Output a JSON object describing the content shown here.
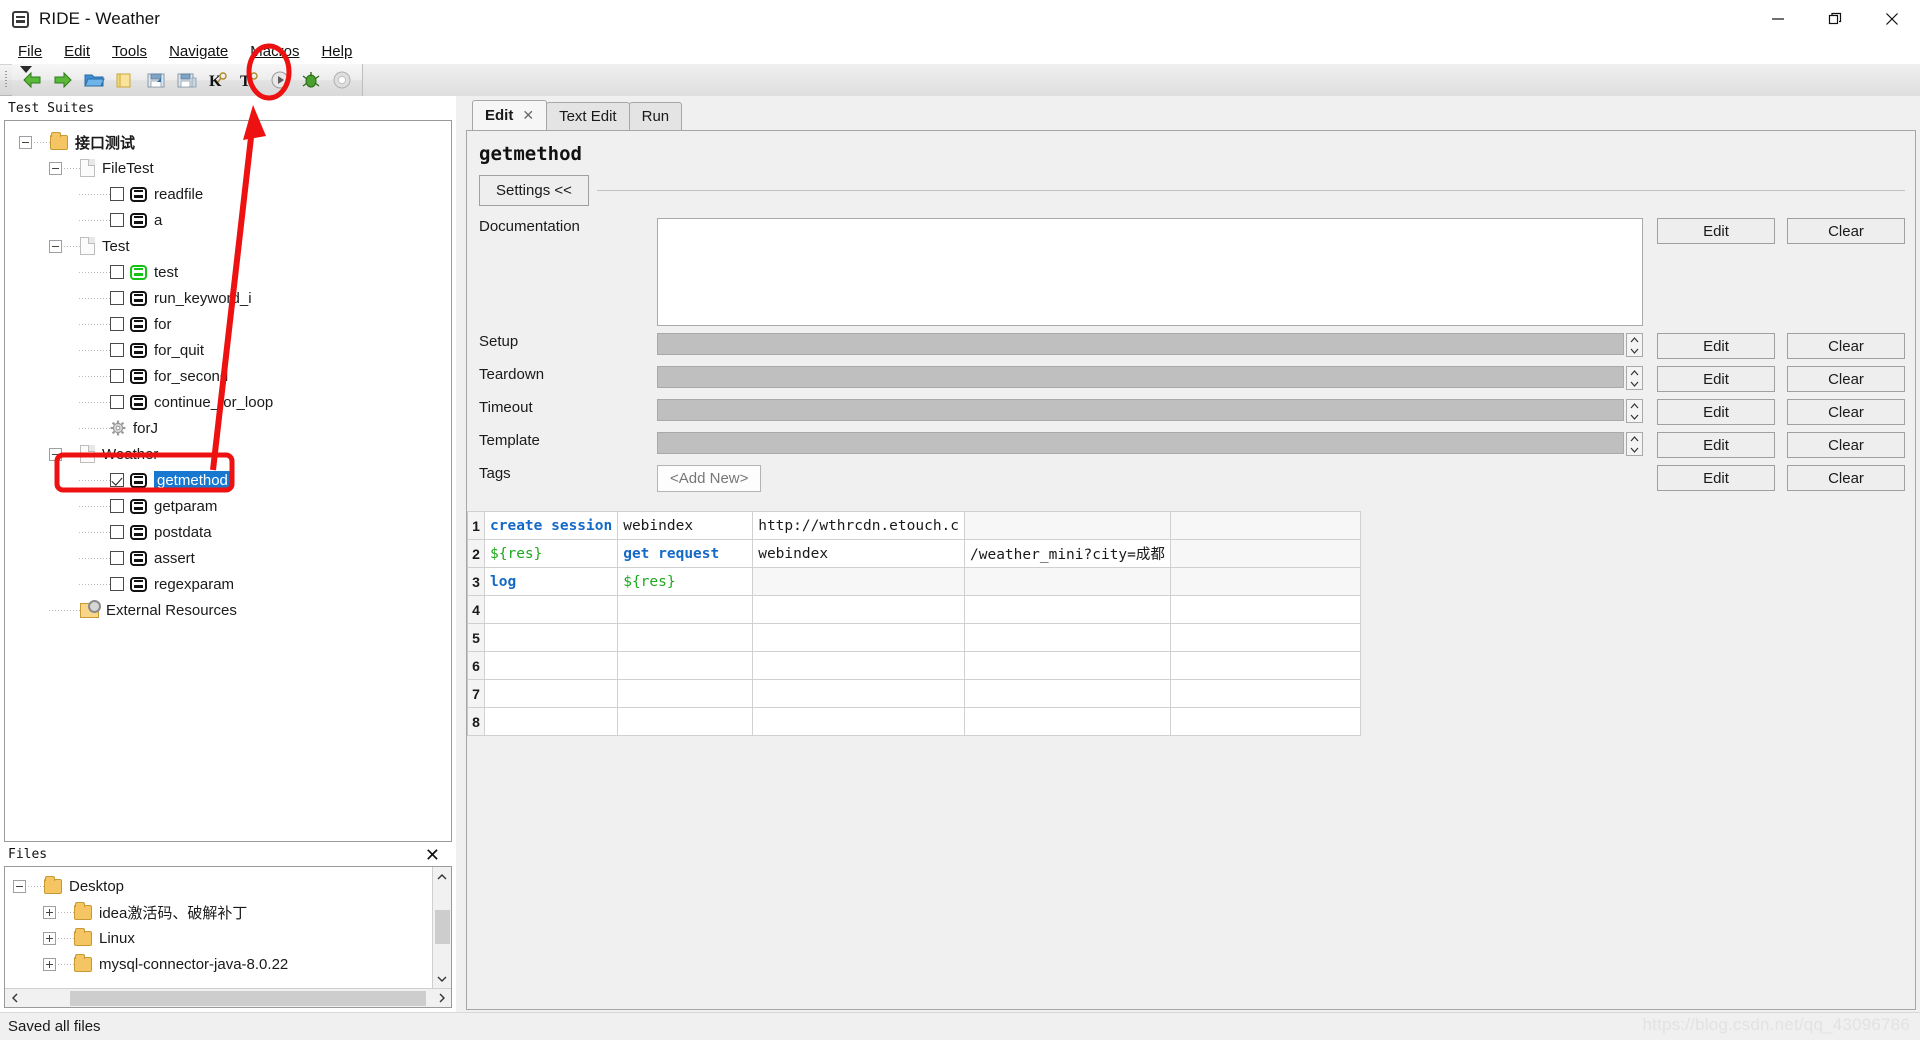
{
  "window": {
    "title": "RIDE - Weather",
    "app_icon": "robot-icon",
    "minimize": "—",
    "maximize": "❐",
    "close": "✕"
  },
  "menubar": {
    "items": [
      {
        "label": "File",
        "mnemonic": "F"
      },
      {
        "label": "Edit",
        "mnemonic": "E"
      },
      {
        "label": "Tools",
        "mnemonic": "T"
      },
      {
        "label": "Navigate",
        "mnemonic": "N"
      },
      {
        "label": "Macros",
        "mnemonic": "M"
      },
      {
        "label": "Help",
        "mnemonic": "H"
      }
    ]
  },
  "toolbar": {
    "buttons": [
      {
        "name": "back-icon",
        "title": "Back"
      },
      {
        "name": "forward-icon",
        "title": "Forward"
      },
      {
        "name": "open-folder-icon",
        "title": "Open Directory"
      },
      {
        "name": "new-folder-icon",
        "title": "New Project"
      },
      {
        "name": "save-icon",
        "title": "Save"
      },
      {
        "name": "save-all-icon",
        "title": "Save All"
      },
      {
        "name": "new-keyword-icon",
        "title": "New Keyword"
      },
      {
        "name": "new-testcase-icon",
        "title": "New Test Case"
      },
      {
        "name": "run-icon",
        "title": "Start"
      },
      {
        "name": "debug-icon",
        "title": "Debug"
      },
      {
        "name": "stop-icon",
        "title": "Stop"
      }
    ]
  },
  "test_suites": {
    "panel_title": "Test Suites",
    "tree": [
      {
        "label": "接口测试",
        "icon": "folder-icon",
        "level": 0,
        "expander": "minus",
        "checkbox": null,
        "bold": true
      },
      {
        "label": "FileTest",
        "icon": "document-icon",
        "level": 1,
        "expander": "minus",
        "checkbox": null,
        "bold": false
      },
      {
        "label": "readfile",
        "icon": "robot-icon",
        "level": 2,
        "expander": null,
        "checkbox": "unchecked",
        "bold": false
      },
      {
        "label": "a",
        "icon": "robot-icon",
        "level": 2,
        "expander": null,
        "checkbox": "unchecked",
        "bold": false
      },
      {
        "label": "Test",
        "icon": "document-icon",
        "level": 1,
        "expander": "minus",
        "checkbox": null,
        "bold": false
      },
      {
        "label": "test",
        "icon": "robot-green-icon",
        "level": 2,
        "expander": null,
        "checkbox": "unchecked",
        "bold": false
      },
      {
        "label": "run_keyword_i",
        "icon": "robot-icon",
        "level": 2,
        "expander": null,
        "checkbox": "unchecked",
        "bold": false
      },
      {
        "label": "for",
        "icon": "robot-icon",
        "level": 2,
        "expander": null,
        "checkbox": "unchecked",
        "bold": false
      },
      {
        "label": "for_quit",
        "icon": "robot-icon",
        "level": 2,
        "expander": null,
        "checkbox": "unchecked",
        "bold": false
      },
      {
        "label": "for_second",
        "icon": "robot-icon",
        "level": 2,
        "expander": null,
        "checkbox": "unchecked",
        "bold": false
      },
      {
        "label": "continue_for_loop",
        "icon": "robot-icon",
        "level": 2,
        "expander": null,
        "checkbox": "unchecked",
        "bold": false
      },
      {
        "label": "forJ",
        "icon": "gear-icon",
        "level": 2,
        "expander": null,
        "checkbox": null,
        "bold": false
      },
      {
        "label": "Weather",
        "icon": "document-icon",
        "level": 1,
        "expander": "minus",
        "checkbox": null,
        "bold": false
      },
      {
        "label": "getmethod",
        "icon": "robot-icon",
        "level": 2,
        "expander": null,
        "checkbox": "checked",
        "bold": false,
        "selected": true
      },
      {
        "label": "getparam",
        "icon": "robot-icon",
        "level": 2,
        "expander": null,
        "checkbox": "unchecked",
        "bold": false
      },
      {
        "label": "postdata",
        "icon": "robot-icon",
        "level": 2,
        "expander": null,
        "checkbox": "unchecked",
        "bold": false
      },
      {
        "label": "assert",
        "icon": "robot-icon",
        "level": 2,
        "expander": null,
        "checkbox": "unchecked",
        "bold": false
      },
      {
        "label": "regexparam",
        "icon": "robot-icon",
        "level": 2,
        "expander": null,
        "checkbox": "unchecked",
        "bold": false
      },
      {
        "label": "External Resources",
        "icon": "external-resources-icon",
        "level": 1,
        "expander": null,
        "checkbox": null,
        "bold": false
      }
    ]
  },
  "files": {
    "panel_title": "Files",
    "close_label": "✕",
    "tree": [
      {
        "label": "Desktop",
        "level": 0,
        "expander": "minus"
      },
      {
        "label": "idea激活码、破解补丁",
        "level": 1,
        "expander": "plus"
      },
      {
        "label": "Linux",
        "level": 1,
        "expander": "plus"
      },
      {
        "label": "mysql-connector-java-8.0.22",
        "level": 1,
        "expander": "plus"
      }
    ]
  },
  "editor": {
    "tabs": [
      {
        "label": "Edit",
        "active": true,
        "closable": true,
        "close_label": "✕"
      },
      {
        "label": "Text Edit",
        "active": false,
        "closable": false
      },
      {
        "label": "Run",
        "active": false,
        "closable": false
      }
    ],
    "keyword_title": "getmethod",
    "settings_toggle": "Settings <<",
    "settings_rows": [
      {
        "label": "Documentation",
        "type": "textarea",
        "value": "",
        "edit": "Edit",
        "clear": "Clear"
      },
      {
        "label": "Setup",
        "type": "text-disabled",
        "value": "",
        "edit": "Edit",
        "clear": "Clear"
      },
      {
        "label": "Teardown",
        "type": "text-disabled",
        "value": "",
        "edit": "Edit",
        "clear": "Clear"
      },
      {
        "label": "Timeout",
        "type": "text-disabled",
        "value": "",
        "edit": "Edit",
        "clear": "Clear"
      },
      {
        "label": "Template",
        "type": "text-disabled",
        "value": "",
        "edit": "Edit",
        "clear": "Clear"
      },
      {
        "label": "Tags",
        "type": "tag-button",
        "value": "<Add New>",
        "edit": "Edit",
        "clear": "Clear"
      }
    ],
    "grid": {
      "row_numbers": [
        "1",
        "2",
        "3",
        "4",
        "5",
        "6",
        "7",
        "8"
      ],
      "rows": [
        [
          {
            "text": "create session",
            "style": "kw"
          },
          {
            "text": "webindex",
            "style": "plain"
          },
          {
            "text": "http://wthrcdn.etouch.c",
            "style": "plain"
          },
          {
            "text": "",
            "style": "empty"
          },
          {
            "text": "",
            "style": "empty"
          }
        ],
        [
          {
            "text": "${res}",
            "style": "var"
          },
          {
            "text": "get request",
            "style": "kw"
          },
          {
            "text": "webindex",
            "style": "plain"
          },
          {
            "text": "/weather_mini?city=成都",
            "style": "plain"
          },
          {
            "text": "",
            "style": "empty"
          }
        ],
        [
          {
            "text": "log",
            "style": "kw"
          },
          {
            "text": "${res}",
            "style": "var"
          },
          {
            "text": "",
            "style": "empty"
          },
          {
            "text": "",
            "style": "empty"
          },
          {
            "text": "",
            "style": "empty"
          }
        ],
        [
          {
            "text": "",
            "style": "blank"
          },
          {
            "text": "",
            "style": "blank"
          },
          {
            "text": "",
            "style": "blank"
          },
          {
            "text": "",
            "style": "blank"
          },
          {
            "text": "",
            "style": "blank"
          }
        ],
        [
          {
            "text": "",
            "style": "blank"
          },
          {
            "text": "",
            "style": "blank"
          },
          {
            "text": "",
            "style": "blank"
          },
          {
            "text": "",
            "style": "blank"
          },
          {
            "text": "",
            "style": "blank"
          }
        ],
        [
          {
            "text": "",
            "style": "blank"
          },
          {
            "text": "",
            "style": "blank"
          },
          {
            "text": "",
            "style": "blank"
          },
          {
            "text": "",
            "style": "blank"
          },
          {
            "text": "",
            "style": "blank"
          }
        ],
        [
          {
            "text": "",
            "style": "blank"
          },
          {
            "text": "",
            "style": "blank"
          },
          {
            "text": "",
            "style": "blank"
          },
          {
            "text": "",
            "style": "blank"
          },
          {
            "text": "",
            "style": "blank"
          }
        ],
        [
          {
            "text": "",
            "style": "blank"
          },
          {
            "text": "",
            "style": "blank"
          },
          {
            "text": "",
            "style": "blank"
          },
          {
            "text": "",
            "style": "blank"
          },
          {
            "text": "",
            "style": "blank"
          }
        ]
      ]
    }
  },
  "status": {
    "message": "Saved all files",
    "watermark": "https://blog.csdn.net/qq_43096786"
  },
  "annotation": {
    "color": "#ee1111",
    "highlight_target": "getmethod-tree-item",
    "arrow_target": "run-toolbar-button"
  }
}
